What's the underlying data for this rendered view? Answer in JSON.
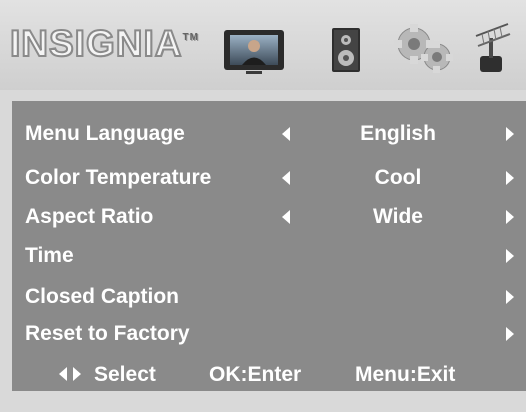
{
  "header": {
    "logo_text": "INSIGNIA",
    "logo_tm": "TM",
    "icons": [
      "tv-picture-icon",
      "speaker-icon",
      "gear-icon",
      "antenna-icon"
    ]
  },
  "menu": {
    "items": [
      {
        "label": "Menu Language",
        "value": "English",
        "has_left": true,
        "has_right": true
      },
      {
        "label": "Color Temperature",
        "value": "Cool",
        "has_left": true,
        "has_right": true
      },
      {
        "label": "Aspect Ratio",
        "value": "Wide",
        "has_left": true,
        "has_right": true
      },
      {
        "label": "Time",
        "value": "",
        "has_left": false,
        "has_right": true
      },
      {
        "label": "Closed Caption",
        "value": "",
        "has_left": false,
        "has_right": true
      },
      {
        "label": "Reset to Factory",
        "value": "",
        "has_left": false,
        "has_right": true
      }
    ]
  },
  "footer": {
    "select_label": "Select",
    "ok_label": "OK:Enter",
    "menu_label": "Menu:Exit"
  },
  "colors": {
    "background": "#d9d9d9",
    "panel": "#8a8a8a",
    "text": "#ffffff"
  }
}
